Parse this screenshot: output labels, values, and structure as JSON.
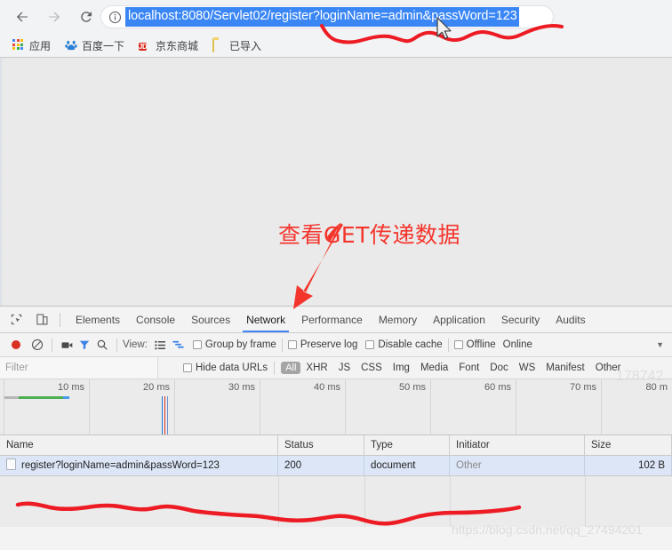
{
  "browser": {
    "nav": {
      "back_icon": "arrow-left-icon",
      "forward_icon": "arrow-right-icon",
      "reload_icon": "reload-icon"
    },
    "omnibox": {
      "info_icon": "page-info-icon",
      "url": "localhost:8080/Servlet02/register?loginName=admin&passWord=123",
      "selected": true,
      "selection_color": "#3a86f4"
    },
    "bookmarks": [
      {
        "icon": "apps-grid-icon",
        "label": "应用"
      },
      {
        "icon": "baidu-icon",
        "label": "百度一下"
      },
      {
        "icon": "jd-icon",
        "label": "京东商城",
        "icon_text": "JD"
      },
      {
        "icon": "folder-icon",
        "label": "已导入"
      }
    ]
  },
  "annotation": {
    "text": "查看GET传递数据",
    "color": "#f4352c"
  },
  "devtools": {
    "left_icons": [
      {
        "name": "inspect-element-icon"
      },
      {
        "name": "device-toolbar-icon"
      }
    ],
    "tabs": [
      {
        "label": "Elements",
        "active": false
      },
      {
        "label": "Console",
        "active": false
      },
      {
        "label": "Sources",
        "active": false
      },
      {
        "label": "Network",
        "active": true
      },
      {
        "label": "Performance",
        "active": false
      },
      {
        "label": "Memory",
        "active": false
      },
      {
        "label": "Application",
        "active": false
      },
      {
        "label": "Security",
        "active": false
      },
      {
        "label": "Audits",
        "active": false
      }
    ],
    "active_tab_color": "#4285f4",
    "network_toolbar": {
      "record_icon": "record-button-icon",
      "clear_icon": "clear-icon",
      "capture_screenshots_icon": "camera-icon",
      "filter_icon": "filter-funnel-icon",
      "search_icon": "search-icon",
      "view_label": "View:",
      "view_list_icon": "list-view-icon",
      "view_waterfall_icon": "waterfall-view-icon",
      "group_by_frame": "Group by frame",
      "preserve_log": "Preserve log",
      "disable_cache": "Disable cache",
      "offline": "Offline",
      "throttling": "Online",
      "caret_icon": "chevron-down-icon"
    },
    "filter_bar": {
      "filter_placeholder": "Filter",
      "hide_data_urls": "Hide data URLs",
      "types": [
        "All",
        "XHR",
        "JS",
        "CSS",
        "Img",
        "Media",
        "Font",
        "Doc",
        "WS",
        "Manifest",
        "Other"
      ],
      "active_type": "All"
    },
    "overview": {
      "tick_labels": [
        "10 ms",
        "20 ms",
        "30 ms",
        "40 ms",
        "50 ms",
        "60 ms",
        "70 ms",
        "80 m"
      ],
      "bar_colors": {
        "stalled": "#b6b6b6",
        "request": "#4caf50",
        "download": "#4a9bf0"
      },
      "marker_colors": {
        "dom_content_loaded": "#1976d2",
        "load": "#d93025"
      }
    },
    "table": {
      "columns": [
        "Name",
        "Status",
        "Type",
        "Initiator",
        "Size"
      ],
      "rows": [
        {
          "name": "register?loginName=admin&passWord=123",
          "status": "200",
          "type": "document",
          "initiator": "Other",
          "size": "102 B",
          "selected": true
        }
      ]
    }
  },
  "watermarks": {
    "bottom": "https://blog.csdn.net/qq_27494201",
    "top": "178742"
  }
}
